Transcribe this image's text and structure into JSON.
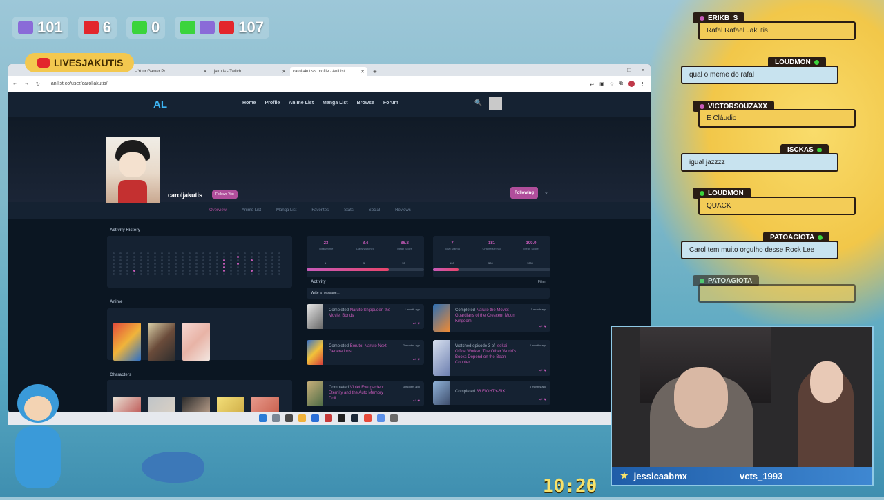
{
  "overlay": {
    "counters": [
      {
        "platform": "twitch-icon",
        "value": "101"
      },
      {
        "platform": "youtube-icon",
        "value": "6"
      },
      {
        "platform": "kick-icon",
        "value": "0"
      },
      {
        "platform": "combined-icon",
        "value": "107"
      }
    ],
    "channel_name": "LIVESJAKUTIS",
    "clock": "10:20",
    "cam_names": [
      "jessicaabmx",
      "vcts_1993"
    ]
  },
  "browser": {
    "tabs": [
      {
        "label": "- Your Gamer Pr..."
      },
      {
        "label": "jakutis - Twitch"
      },
      {
        "label": "caroljakutis's profile · AniList"
      }
    ],
    "url": "anilist.co/user/caroljakutis/"
  },
  "anilist": {
    "logo": "AL",
    "nav": [
      "Home",
      "Profile",
      "Anime List",
      "Manga List",
      "Browse",
      "Forum"
    ],
    "username": "caroljakutis",
    "follows_you": "Follows You",
    "following_button": "Following",
    "subnav": [
      "Overview",
      "Anime List",
      "Manga List",
      "Favorites",
      "Stats",
      "Social",
      "Reviews"
    ],
    "activity_history_title": "Activity History",
    "anime_title": "Anime",
    "characters_title": "Characters",
    "anime_stats": [
      {
        "value": "23",
        "label": "Total Anime"
      },
      {
        "value": "8.4",
        "label": "Days Watched"
      },
      {
        "value": "86.8",
        "label": "Mean Score"
      }
    ],
    "manga_stats": [
      {
        "value": "7",
        "label": "Total Manga"
      },
      {
        "value": "181",
        "label": "Chapters Read"
      },
      {
        "value": "100.0",
        "label": "Mean Score"
      }
    ],
    "anime_bar": {
      "ticks": [
        "1",
        "5",
        "10"
      ],
      "fill": 0.7
    },
    "manga_bar": {
      "ticks": [
        "100",
        "500",
        "1000"
      ],
      "fill": 0.22
    },
    "activity_title": "Activity",
    "filter": "Filter",
    "write_message": "Write a message...",
    "activities_left": [
      {
        "prefix": "Completed ",
        "title": "Naruto Shippuden the Movie: Bonds",
        "time": "1 month ago"
      },
      {
        "prefix": "Completed ",
        "title": "Boruto: Naruto Next Generations",
        "time": "2 months ago"
      },
      {
        "prefix": "Completed ",
        "title": "Violet Evergarden: Eternity and the Auto Memory Doll",
        "time": "3 months ago"
      }
    ],
    "activities_right": [
      {
        "prefix": "Completed ",
        "title": "Naruto the Movie: Guardians of the Crescent Moon Kingdom",
        "time": "1 month ago"
      },
      {
        "prefix": "Watched episode 3 of ",
        "title": "Isekai Office Worker: The Other World's Books Depend on the Bean Counter",
        "time": "2 months ago"
      },
      {
        "prefix": "Completed ",
        "title": "86 EIGHTY-SIX",
        "time": "3 months ago"
      }
    ]
  },
  "chat": [
    {
      "user": "ERIKB_S",
      "msg": "Rafal Rafael Jakutis",
      "style": "y",
      "side": "left"
    },
    {
      "user": "LOUDMON",
      "msg": "qual o meme do rafal",
      "style": "b",
      "side": "right"
    },
    {
      "user": "VICTORSOUZAXX",
      "msg": "É Cláudio",
      "style": "y",
      "side": "left"
    },
    {
      "user": "ISCKAS",
      "msg": "igual jazzzz",
      "style": "b",
      "side": "right"
    },
    {
      "user": "LOUDMON",
      "msg": "QUACK",
      "style": "y",
      "side": "left"
    },
    {
      "user": "PATOAGIOTA",
      "msg": "Carol tem muito orgulho desse Rock Lee",
      "style": "b",
      "side": "right"
    },
    {
      "user": "PATOAGIOTA",
      "msg": "",
      "style": "y",
      "side": "left"
    }
  ]
}
